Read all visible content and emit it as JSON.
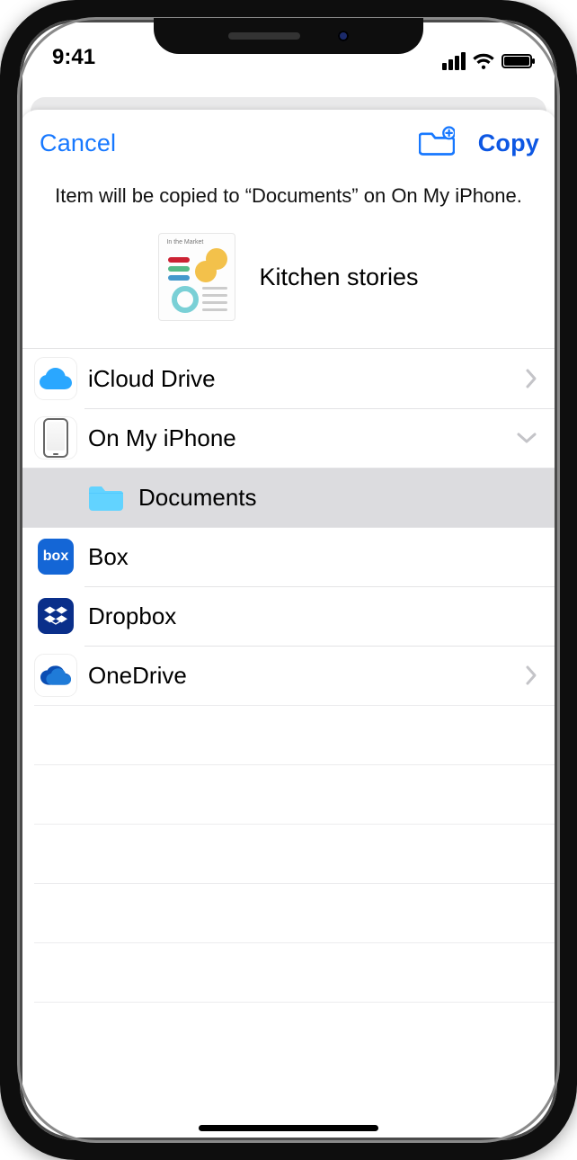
{
  "status": {
    "time": "9:41"
  },
  "nav": {
    "cancel": "Cancel",
    "copy": "Copy"
  },
  "message": "Item will be copied to “Documents” on On My iPhone.",
  "item": {
    "title": "Kitchen stories",
    "thumb_header": "In the Market"
  },
  "locations": [
    {
      "id": "icloud",
      "label": "iCloud Drive",
      "accessory": "chevron"
    },
    {
      "id": "oniphone",
      "label": "On My iPhone",
      "accessory": "expand"
    },
    {
      "id": "docs",
      "label": "Documents",
      "accessory": "none",
      "indent": true,
      "selected": true
    },
    {
      "id": "box",
      "label": "Box",
      "accessory": "none"
    },
    {
      "id": "dropbox",
      "label": "Dropbox",
      "accessory": "none"
    },
    {
      "id": "onedrive",
      "label": "OneDrive",
      "accessory": "chevron"
    }
  ]
}
